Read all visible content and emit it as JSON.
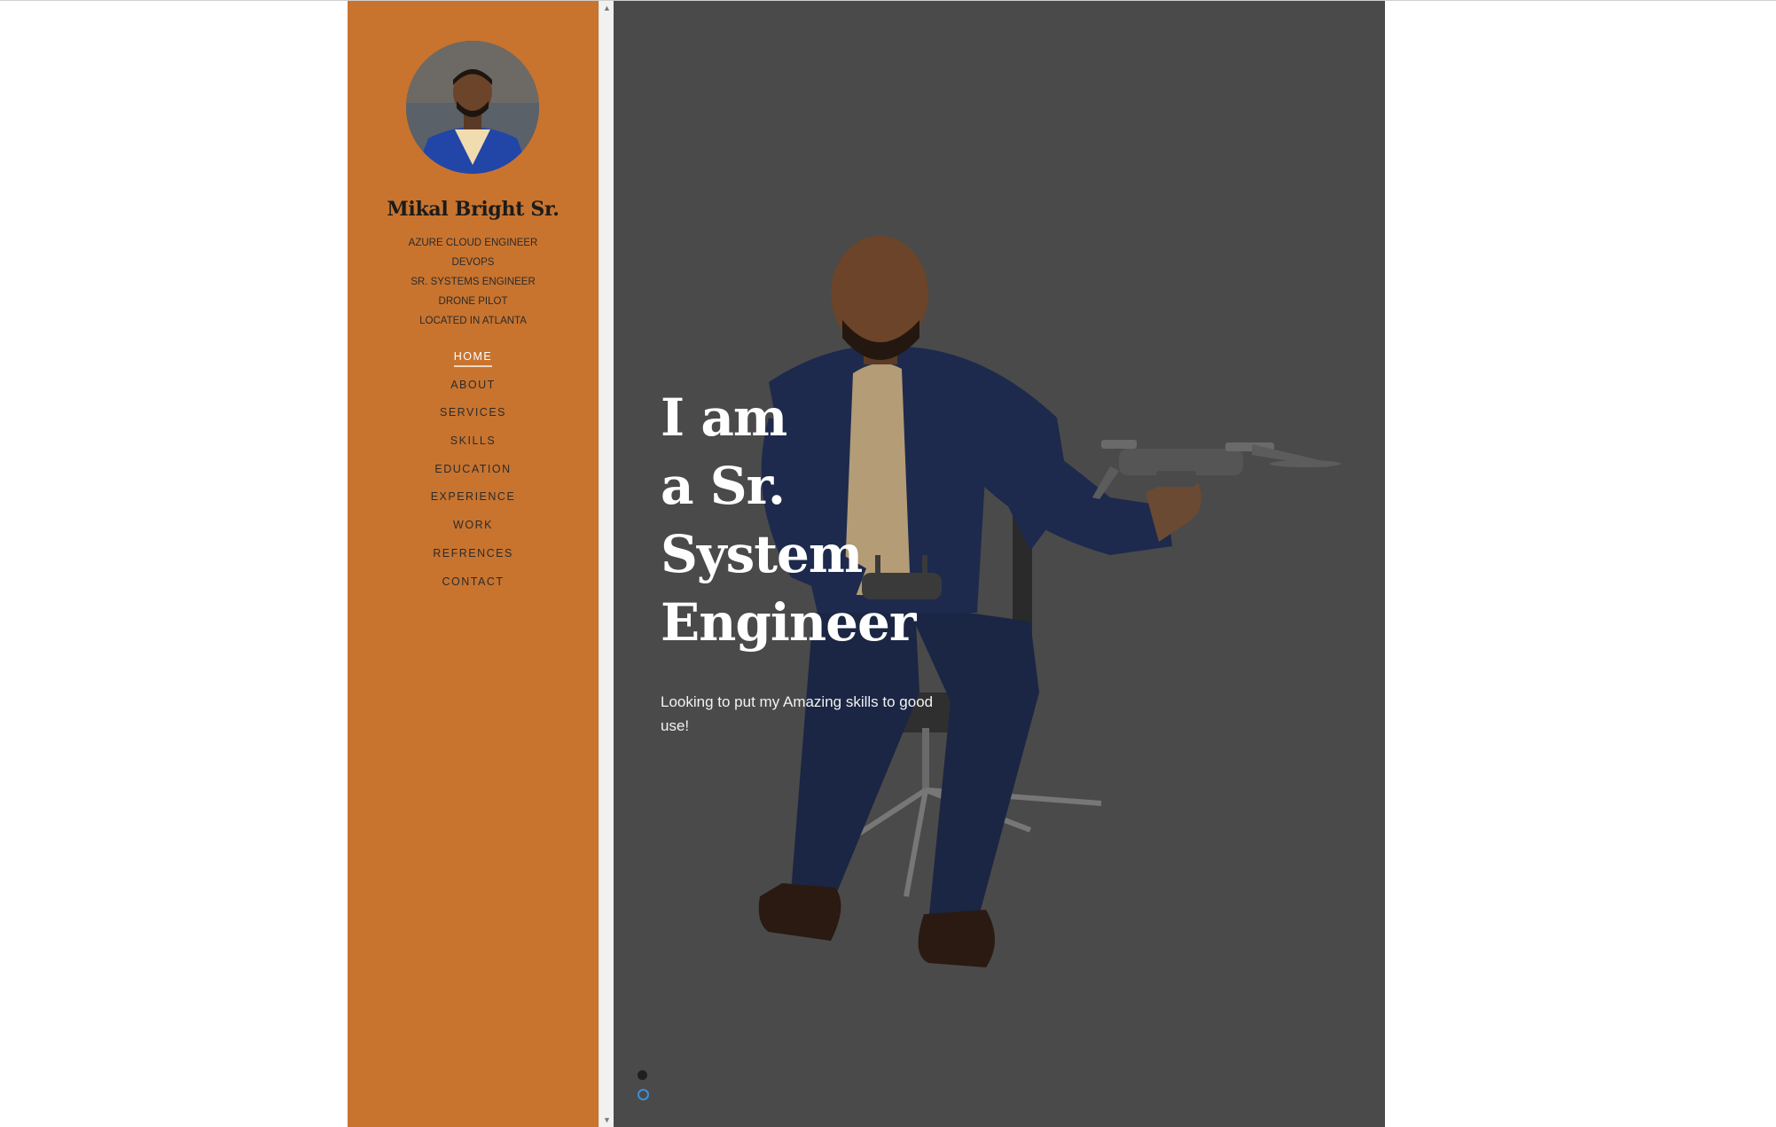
{
  "profile": {
    "name": "Mikal Bright Sr.",
    "titles": [
      "AZURE CLOUD ENGINEER",
      "DEVOPS",
      "SR. SYSTEMS ENGINEER",
      "DRONE PILOT",
      "LOCATED IN ATLANTA"
    ]
  },
  "nav": {
    "items": [
      {
        "label": "HOME",
        "active": true
      },
      {
        "label": "ABOUT"
      },
      {
        "label": "SERVICES"
      },
      {
        "label": "SKILLS"
      },
      {
        "label": "EDUCATION"
      },
      {
        "label": "EXPERIENCE"
      },
      {
        "label": "WORK"
      },
      {
        "label": "REFRENCES"
      },
      {
        "label": "CONTACT"
      }
    ]
  },
  "hero": {
    "heading_lines": [
      "I am",
      "a Sr.",
      "System",
      "Engineer"
    ],
    "subtitle": "Looking to put my Amazing skills to good use!"
  },
  "colors": {
    "sidebar_bg": "#c8742f",
    "hero_overlay": "#4a4a4a",
    "active_dot": "#3b8fd9"
  }
}
